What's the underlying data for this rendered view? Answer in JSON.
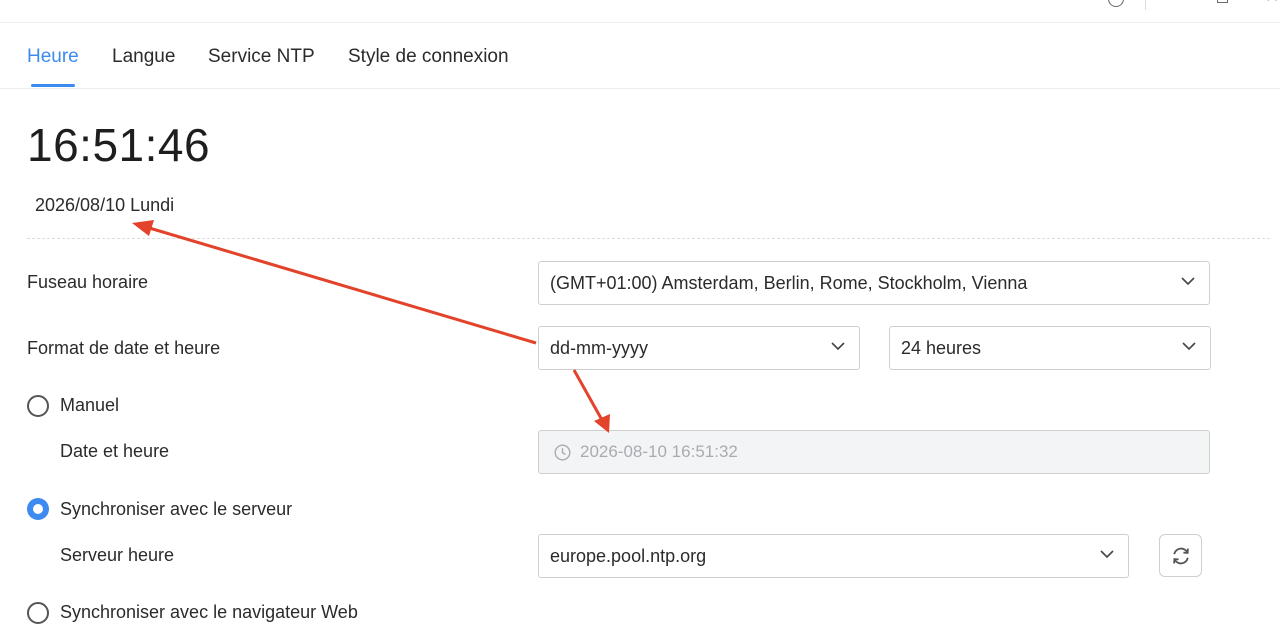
{
  "tabs": [
    {
      "label": "Heure",
      "active": true
    },
    {
      "label": "Langue",
      "active": false
    },
    {
      "label": "Service NTP",
      "active": false
    },
    {
      "label": "Style de connexion",
      "active": false
    }
  ],
  "clock": {
    "time": "16:51:46",
    "date": "2026/08/10 Lundi"
  },
  "timezone": {
    "label": "Fuseau horaire",
    "value": "(GMT+01:00) Amsterdam, Berlin, Rome, Stockholm, Vienna"
  },
  "format": {
    "label": "Format de date et heure",
    "date_format": "dd-mm-yyyy",
    "hour_format": "24 heures"
  },
  "manual": {
    "label": "Manuel",
    "checked": false,
    "datetime_label": "Date et heure",
    "datetime_value": "2026-08-10 16:51:32"
  },
  "sync_server": {
    "label": "Synchroniser avec le serveur",
    "checked": true,
    "server_label": "Serveur heure",
    "server_value": "europe.pool.ntp.org"
  },
  "sync_browser": {
    "label": "Synchroniser avec le navigateur Web",
    "checked": false
  },
  "colors": {
    "accent": "#3d8af0",
    "annotation": "#e2432a"
  },
  "icons": {
    "window": [
      "help-icon",
      "maximize-icon",
      "close-icon"
    ],
    "chevron": "chevron-down-icon",
    "clock": "clock-icon",
    "refresh": "refresh-icon"
  }
}
